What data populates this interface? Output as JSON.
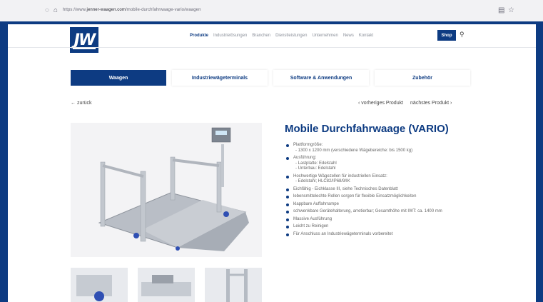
{
  "browser": {
    "url_prefix": "https://www.",
    "url_domain": "jenner-waagen.com",
    "url_path": "/mobile-durchfahrwaage-vario/waagen",
    "icons": [
      "shield-icon",
      "lock-icon",
      "reader-icon",
      "star-icon"
    ]
  },
  "header": {
    "logo": "JW",
    "nav": [
      "Produkte",
      "Industrielösungen",
      "Branchen",
      "Dienstleistungen",
      "Unternehmen",
      "News",
      "Kontakt"
    ],
    "shop": "Shop"
  },
  "tabs": [
    "Waagen",
    "Industriewägeterminals",
    "Software & Anwendungen",
    "Zubehör"
  ],
  "navigation": {
    "back": "← zurück",
    "prev": "‹ vorheriges Produkt",
    "next": "nächstes Produkt ›"
  },
  "product": {
    "title": "Mobile Durchfahrwaage (VARIO)",
    "specs": [
      {
        "main": "Plattformgröße:",
        "subs": [
          "- 1300 x 1200 mm (verschiedene Wägebereiche: bis 1500 kg)"
        ]
      },
      {
        "main": "Ausführung:",
        "subs": [
          "- Lastplatte: Edelstahl",
          "- Unterbau: Edelstahl"
        ]
      },
      {
        "main": "Hochwertige Wägezellen für industriellen Einsatz:",
        "subs": [
          "- Edelstahl; HLC82/IP68/9/IK"
        ]
      },
      {
        "main": "Eichfähig - Eichklasse III, siehe Technisches Datenblatt",
        "subs": []
      },
      {
        "main": "lebensmittelechte Rollen sorgen für flexible Einsatzmöglichkeiten",
        "subs": []
      },
      {
        "main": "klappbare Auffahrrampe",
        "subs": []
      },
      {
        "main": "schwenkbare Gerätehalterung, arretierbar; Gesamthöhe mit IWT: ca. 1400 mm",
        "subs": []
      },
      {
        "main": "Massive Ausführung",
        "subs": []
      },
      {
        "main": "Leicht zu Reinigen",
        "subs": []
      },
      {
        "main": "Für Anschluss an Industriewägeterminals vorbereitet",
        "subs": []
      }
    ]
  },
  "colors": {
    "brand": "#0d3b82",
    "frame": "#0d3b82"
  }
}
